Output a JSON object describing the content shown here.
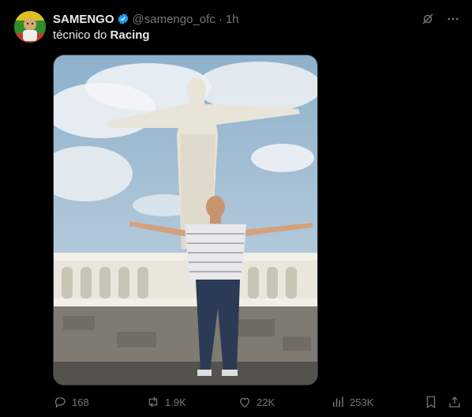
{
  "tweet": {
    "author_name": "SAMENGO",
    "handle": "@samengo_ofc",
    "separator": "·",
    "time": "1h",
    "text_prefix": "técnico do ",
    "text_bold": "Racing"
  },
  "icons": {
    "verified": "verified-badge-icon",
    "grok": "grok-icon",
    "more": "more-icon",
    "reply": "reply-icon",
    "retweet": "retweet-icon",
    "like": "heart-icon",
    "views": "views-icon",
    "bookmark": "bookmark-icon",
    "share": "share-icon"
  },
  "stats": {
    "replies": "168",
    "retweets": "1.9K",
    "likes": "22K",
    "views": "253K"
  },
  "colors": {
    "background": "#000000",
    "text": "#e7e9ea",
    "muted": "#71767b",
    "verified": "#1d9bf0"
  }
}
